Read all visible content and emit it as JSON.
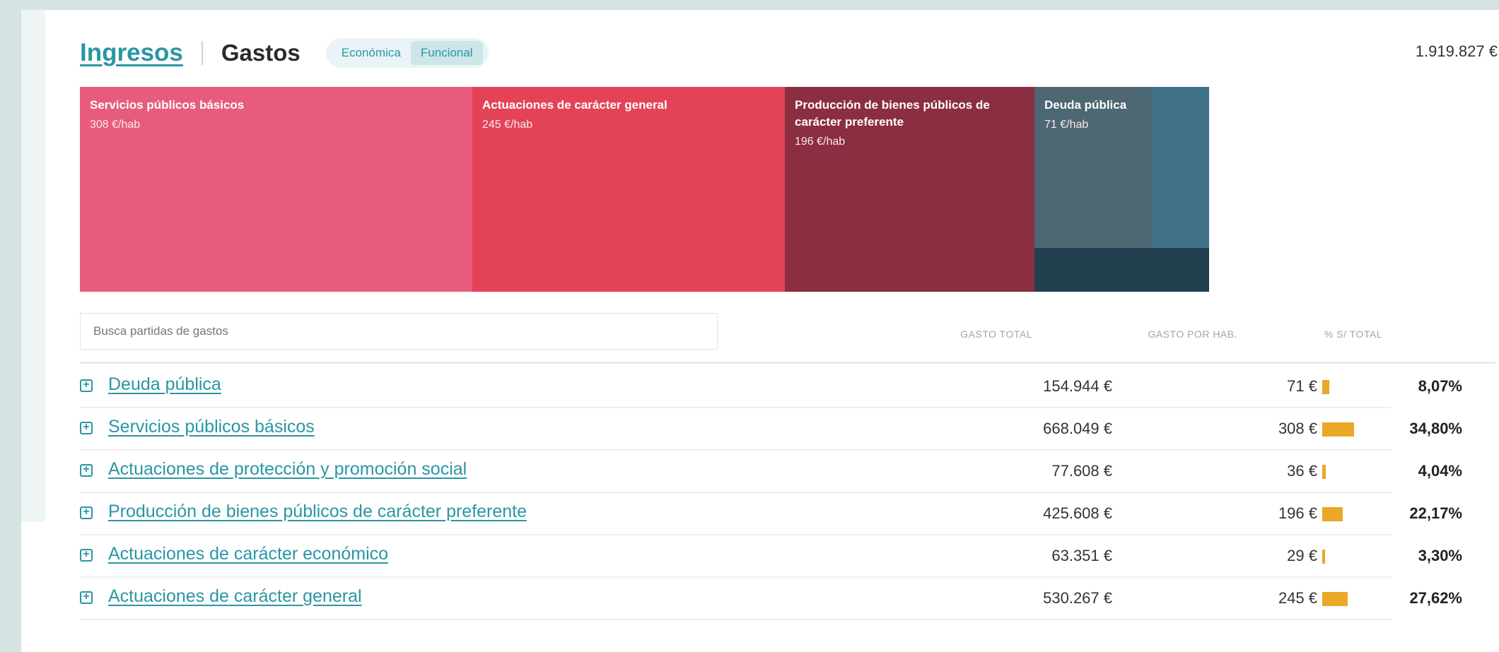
{
  "header": {
    "tab_ingresos": "Ingresos",
    "tab_gastos": "Gastos",
    "toggle": {
      "economica": "Económica",
      "funcional": "Funcional",
      "selected": "Funcional"
    },
    "total": "1.919.827 €"
  },
  "treemap": {
    "colors": [
      "#e75c7c",
      "#e44357",
      "#8b2e41",
      "#4d6773",
      "#3f7189",
      "#213f4f"
    ],
    "tiles": [
      {
        "name": "Servicios públicos básicos",
        "value": "308 €/hab"
      },
      {
        "name": "Actuaciones de carácter general",
        "value": "245 €/hab"
      },
      {
        "name": "Producción de bienes públicos de carácter preferente",
        "value": "196 €/hab"
      },
      {
        "name": "Deuda pública",
        "value": "71 €/hab"
      },
      {
        "name": "",
        "value": ""
      },
      {
        "name": "",
        "value": ""
      }
    ]
  },
  "table": {
    "search_placeholder": "Busca partidas de gastos",
    "columns": {
      "total": "GASTO TOTAL",
      "per_hab": "GASTO POR HAB.",
      "pct": "% S/ TOTAL"
    },
    "rows": [
      {
        "name": "Deuda pública",
        "total": "154.944 €",
        "per_hab": "71 €",
        "pct": "8,07%",
        "share": 0.0807
      },
      {
        "name": "Servicios públicos básicos",
        "total": "668.049 €",
        "per_hab": "308 €",
        "pct": "34,80%",
        "share": 0.348
      },
      {
        "name": "Actuaciones de protección y promoción social",
        "total": "77.608 €",
        "per_hab": "36 €",
        "pct": "4,04%",
        "share": 0.0404
      },
      {
        "name": "Producción de bienes públicos de carácter preferente",
        "total": "425.608 €",
        "per_hab": "196 €",
        "pct": "22,17%",
        "share": 0.2217
      },
      {
        "name": "Actuaciones de carácter económico",
        "total": "63.351 €",
        "per_hab": "29 €",
        "pct": "3,30%",
        "share": 0.033
      },
      {
        "name": "Actuaciones de carácter general",
        "total": "530.267 €",
        "per_hab": "245 €",
        "pct": "27,62%",
        "share": 0.2762
      }
    ]
  }
}
